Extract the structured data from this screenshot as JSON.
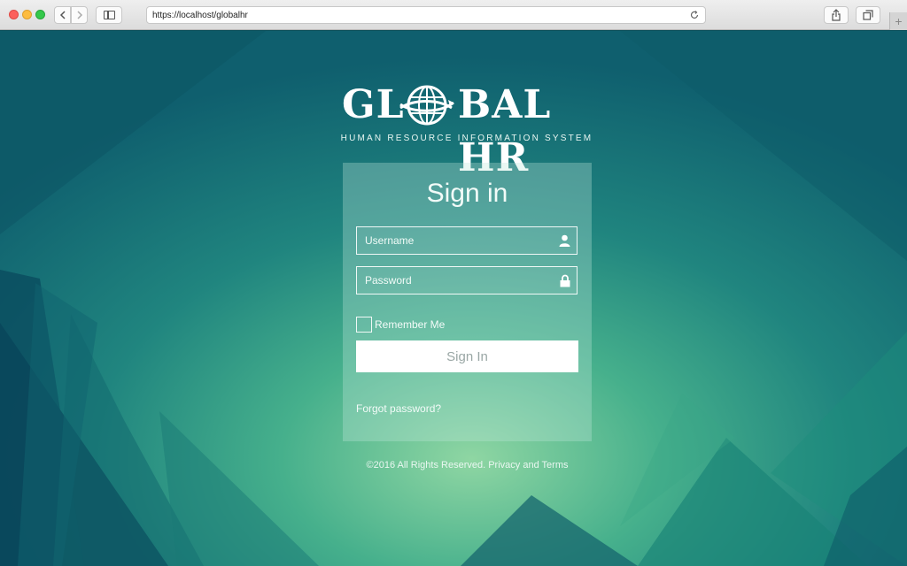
{
  "browser": {
    "url": "https://localhost/globalhr",
    "back_icon": "chevron-left-icon",
    "forward_icon": "chevron-right-icon",
    "new_tab_label": "+"
  },
  "brand": {
    "name_left": "GL",
    "name_right": "BAL HR",
    "tagline": "HUMAN RESOURCE INFORMATION SYSTEM",
    "logo_icon": "globe-icon"
  },
  "login": {
    "title": "Sign in",
    "username_placeholder": "Username",
    "password_placeholder": "Password",
    "remember_label": "Remember Me",
    "remember_checked": false,
    "submit_label": "Sign In",
    "forgot_label": "Forgot password?"
  },
  "footer": {
    "text": "©2016 All Rights Reserved. Privacy and Terms"
  },
  "colors": {
    "page_bg_dark": "#0f5f6e",
    "page_bg_light": "#8fd6a3",
    "button_bg": "#ffffff",
    "button_text": "#9aa7a5"
  }
}
